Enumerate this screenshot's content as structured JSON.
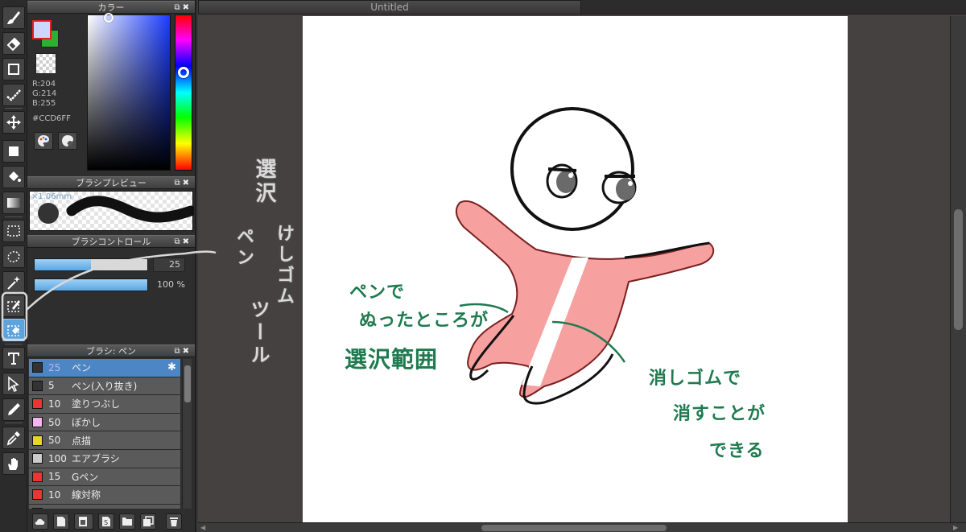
{
  "document": {
    "tab_title": "Untitled"
  },
  "colors": {
    "accent": "#5fa3dd",
    "selected_row": "#4d86c4",
    "foreground": "#CCD6FF",
    "background_swatch": "#2fae2f",
    "annotation_green": "#1f7a4f",
    "figure_pink": "#f7a0a0"
  },
  "toolbar": {
    "tools": [
      {
        "name": "brush-tool",
        "icon": "brush-icon"
      },
      {
        "name": "eraser-tool",
        "icon": "eraser-icon"
      },
      {
        "name": "rectangle-tool",
        "icon": "square-icon"
      },
      {
        "name": "dot-tool",
        "icon": "dot-pen-icon"
      },
      {
        "name": "move-tool",
        "icon": "move-icon"
      },
      {
        "name": "fill-rect-tool",
        "icon": "filled-square-icon"
      },
      {
        "name": "bucket-tool",
        "icon": "bucket-icon"
      },
      {
        "name": "gradation-tool",
        "icon": "gradient-icon"
      },
      {
        "name": "select-tool",
        "icon": "select-rect-icon"
      },
      {
        "name": "lasso-tool",
        "icon": "lasso-icon"
      },
      {
        "name": "magic-wand-tool",
        "icon": "magic-wand-icon"
      },
      {
        "name": "select-pen-tool",
        "icon": "select-pen-icon"
      },
      {
        "name": "select-eraser-tool",
        "icon": "select-eraser-icon"
      },
      {
        "name": "text-tool",
        "icon": "text-icon"
      },
      {
        "name": "operation-tool",
        "icon": "cursor-icon"
      },
      {
        "name": "divide-tool",
        "icon": "pen-nib-icon"
      },
      {
        "name": "eyedropper-tool",
        "icon": "eyedropper-icon"
      },
      {
        "name": "hand-tool",
        "icon": "hand-icon"
      }
    ]
  },
  "color_panel": {
    "title": "カラー",
    "r": "R:204",
    "g": "G:214",
    "b": "B:255",
    "hex": "#CCD6FF"
  },
  "brush_preview": {
    "title": "ブラシプレビュー",
    "size": "×1.06mm"
  },
  "brush_control": {
    "title": "ブラシコントロール",
    "size_value": "25",
    "size_fraction": 0.5,
    "opacity_value": "100 %",
    "opacity_fraction": 1.0
  },
  "brush_list": {
    "title": "ブラシ: ペン",
    "items": [
      {
        "size": "25",
        "name": "ペン",
        "color": "#333333",
        "selected": true
      },
      {
        "size": "5",
        "name": "ペン(入り抜き)",
        "color": "#333333"
      },
      {
        "size": "10",
        "name": "塗りつぶし",
        "color": "#ee3333"
      },
      {
        "size": "50",
        "name": "ぼかし",
        "color": "#f5b5f0"
      },
      {
        "size": "50",
        "name": "点描",
        "color": "#e6d52a"
      },
      {
        "size": "100",
        "name": "エアブラシ",
        "color": "#cccccc"
      },
      {
        "size": "15",
        "name": "Gペン",
        "color": "#ee3333"
      },
      {
        "size": "10",
        "name": "線対称",
        "color": "#ee3333"
      },
      {
        "size": "",
        "name": "",
        "color": "#33aa33"
      }
    ]
  },
  "annotations": {
    "left_1": "選沢",
    "left_2": "ペン",
    "left_3": "けしゴム",
    "left_4": "ツール",
    "pen_line1": "ペンで",
    "pen_line2": "ぬったところが",
    "pen_line3": "選沢範囲",
    "eraser_line1": "消しゴムで",
    "eraser_line2": "消すことが",
    "eraser_line3": "できる"
  }
}
